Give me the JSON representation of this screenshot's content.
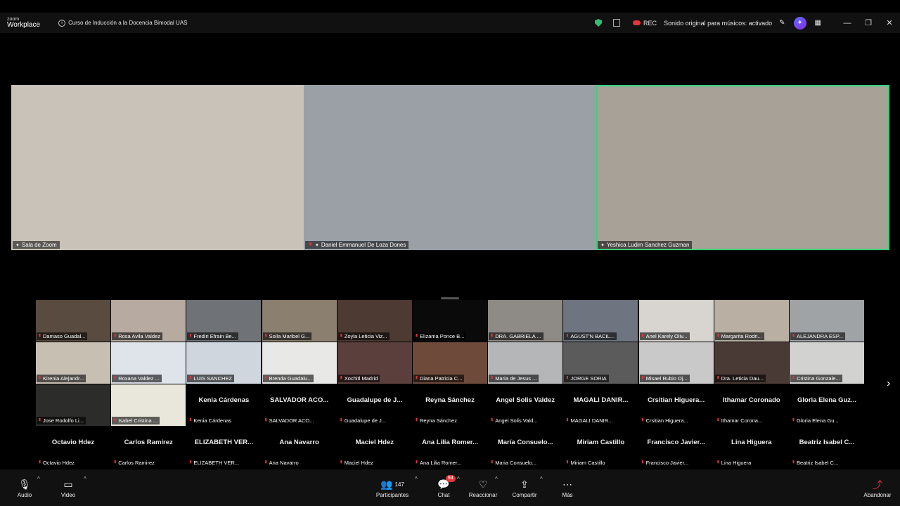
{
  "app": {
    "logo_top": "zoom",
    "logo_bottom": "Workplace"
  },
  "meeting": {
    "title": "Curso de Inducción a la Docencia Bimodal UAS"
  },
  "topbar": {
    "rec_label": "REC",
    "sound_label": "Sonido original para músicos: activado"
  },
  "colors": {
    "active_speaker": "#39d37a",
    "muted": "#e5353b",
    "ai_badge": "#5b6cff"
  },
  "speakers": [
    {
      "name": "Sala de Zoom",
      "muted": false,
      "bg": "#c9c2b8",
      "active": false
    },
    {
      "name": "Daniel Emmanuel De Loza Dones",
      "muted": true,
      "bg": "#9aa0a6",
      "active": false
    },
    {
      "name": "Yeshica Ludim Sanchez Guzman",
      "muted": false,
      "bg": "#a8a197",
      "active": true
    }
  ],
  "gallery": [
    {
      "label": "Damaso Guadal...",
      "video": true,
      "bg": "#5a4b40"
    },
    {
      "label": "Rosa Avila Valdez",
      "video": true,
      "bg": "#b7aaa1"
    },
    {
      "label": "Frediri Efrain Be...",
      "video": true,
      "bg": "#6f7378"
    },
    {
      "label": "Soila Maribel G...",
      "video": true,
      "bg": "#8b7f70"
    },
    {
      "label": "Zoyla Leticia Viz...",
      "video": true,
      "bg": "#4d3a32"
    },
    {
      "label": "Elizama Ponce B...",
      "video": true,
      "bg": "#0a0a0a"
    },
    {
      "label": "DRA. GABRIELA ...",
      "video": true,
      "bg": "#8e8a86"
    },
    {
      "label": "AGUST'N BACIL...",
      "video": true,
      "bg": "#6e7580"
    },
    {
      "label": "Anel Karely Oliv...",
      "video": true,
      "bg": "#d8d4cf"
    },
    {
      "label": "Margarita Rodri...",
      "video": true,
      "bg": "#b9b0a3"
    },
    {
      "label": "ALEJANDRA ESP...",
      "video": true,
      "bg": "#9fa3a6"
    },
    {
      "label": "Kirenia Alejandr...",
      "video": true,
      "bg": "#c8bfb3"
    },
    {
      "label": "Roxana Valdez ...",
      "video": true,
      "bg": "#dfe3ea"
    },
    {
      "label": "LUIS SANCHEZ",
      "video": true,
      "bg": "#cfd6de"
    },
    {
      "label": "Brenda Guadalu...",
      "video": true,
      "bg": "#e8e8e6"
    },
    {
      "label": "Xochitl Madrid",
      "video": true,
      "bg": "#5a3f3c"
    },
    {
      "label": "Diana Patricia C...",
      "video": true,
      "bg": "#6d4a3a"
    },
    {
      "label": "Maria de Jesus ...",
      "video": true,
      "bg": "#b4b6b8"
    },
    {
      "label": "JORGE SORIA",
      "video": true,
      "bg": "#5b5b5b"
    },
    {
      "label": "Misael Rubio Oj...",
      "video": true,
      "bg": "#c9c9c9"
    },
    {
      "label": "Dra. Leticia Dau...",
      "video": true,
      "bg": "#4a3a36"
    },
    {
      "label": "Cristina Gonzale...",
      "video": true,
      "bg": "#d2d2d0"
    },
    {
      "label": "Jose Rodolfo Li...",
      "video": true,
      "bg": "#2c2c2a"
    },
    {
      "label": "Isabel Cristina ...",
      "video": true,
      "bg": "#e9e6dc"
    },
    {
      "name": "Kenia Cárdenas",
      "label": "Kenia Cárdenas",
      "video": false
    },
    {
      "name": "SALVADOR ACO...",
      "label": "SALVADOR ACO...",
      "video": false
    },
    {
      "name": "Guadalupe de J...",
      "label": "Guadalupe de J...",
      "video": false
    },
    {
      "name": "Reyna Sánchez",
      "label": "Reyna Sánchez",
      "video": false
    },
    {
      "name": "Angel Solis Valdez",
      "label": "Angel Solis Vald...",
      "video": false
    },
    {
      "name": "MAGALI DANIR...",
      "label": "MAGALI DANIR...",
      "video": false
    },
    {
      "name": "Crsitian Higuera...",
      "label": "Crsitian Higuera...",
      "video": false
    },
    {
      "name": "Ithamar Coronado",
      "label": "Ithamar Corona...",
      "video": false
    },
    {
      "name": "Gloria Elena Guz...",
      "label": "Gloria Elena Gu...",
      "video": false
    },
    {
      "name": "Octavio Hdez",
      "label": "Octavio Hdez",
      "video": false
    },
    {
      "name": "Carlos Ramirez",
      "label": "Carlos Ramirez",
      "video": false
    },
    {
      "name": "ELIZABETH VER...",
      "label": "ELIZABETH VER...",
      "video": false
    },
    {
      "name": "Ana Navarro",
      "label": "Ana Navarro",
      "video": false
    },
    {
      "name": "Maciel Hdez",
      "label": "Maciel Hdez",
      "video": false
    },
    {
      "name": "Ana Lilia Romer...",
      "label": "Ana Lilia Romer...",
      "video": false
    },
    {
      "name": "María Consuelo...",
      "label": "Maria Consuelo...",
      "video": false
    },
    {
      "name": "Miriam Castillo",
      "label": "Miriam Castillo",
      "video": false
    },
    {
      "name": "Francisco Javier...",
      "label": "Francisco Javier...",
      "video": false
    },
    {
      "name": "Lina Higuera",
      "label": "Lina Higuera",
      "video": false
    },
    {
      "name": "Beatriz Isabel C...",
      "label": "Beatriz Isabel C...",
      "video": false
    }
  ],
  "toolbar": {
    "audio": "Audio",
    "video": "Video",
    "participants": "Participantes",
    "participants_count": "147",
    "chat": "Chat",
    "chat_badge": "94",
    "react": "Reaccionar",
    "share": "Compartir",
    "more": "Más",
    "leave": "Abandonar"
  },
  "icons": [
    "info-icon",
    "shield-icon",
    "notes-icon",
    "cloud-rec-icon",
    "magic-wand-icon",
    "ai-companion-icon",
    "grid-icon",
    "minimize-icon",
    "restore-icon",
    "close-icon",
    "mic-muted-icon",
    "video-off-icon",
    "participants-icon",
    "chat-icon",
    "react-icon",
    "share-icon",
    "more-icon",
    "leave-icon",
    "next-page-icon"
  ]
}
